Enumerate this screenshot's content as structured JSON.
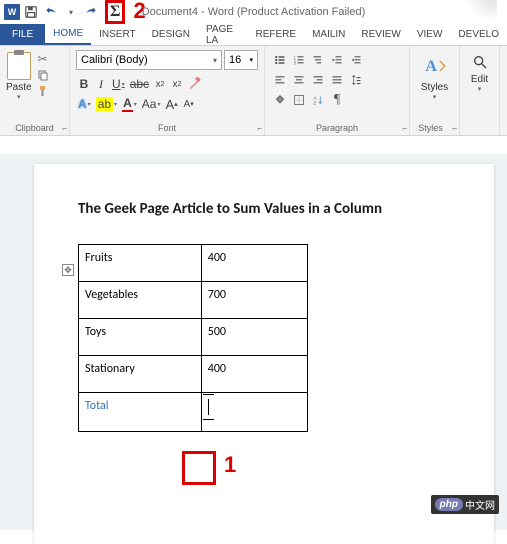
{
  "annotations": {
    "one": "1",
    "two": "2"
  },
  "title": "Document4 - Word (Product Activation Failed)",
  "tabs": {
    "file": "FILE",
    "home": "HOME",
    "insert": "INSERT",
    "design": "DESIGN",
    "pagela": "PAGE LA",
    "refere": "REFERE",
    "mailin": "MAILIN",
    "review": "REVIEW",
    "view": "VIEW",
    "develo": "DEVELO"
  },
  "ribbon": {
    "paste": "Paste",
    "font_name": "Calibri (Body)",
    "font_size": "16",
    "bold": "B",
    "italic": "I",
    "underline": "U",
    "strike": "abc",
    "sub_x": "x",
    "sup_x": "x",
    "clear": "A",
    "grow": "A",
    "shrink": "A",
    "aacase": "Aa",
    "highlight_ab": "ab",
    "font_color": "A",
    "group_clipboard": "Clipboard",
    "group_font": "Font",
    "group_paragraph": "Paragraph",
    "group_styles": "Styles",
    "group_editing": "Edit",
    "styles_label": "Styles",
    "editing_label": "Edit",
    "pilcrow": "¶"
  },
  "document": {
    "heading": "The Geek Page Article to Sum Values in a Column",
    "rows": [
      {
        "label": "Fruits",
        "value": "400"
      },
      {
        "label": "Vegetables",
        "value": "700"
      },
      {
        "label": "Toys",
        "value": "500"
      },
      {
        "label": "Stationary",
        "value": "400"
      }
    ],
    "total_label": "Total"
  },
  "watermark": {
    "php": "php",
    "cn": "中文网"
  }
}
